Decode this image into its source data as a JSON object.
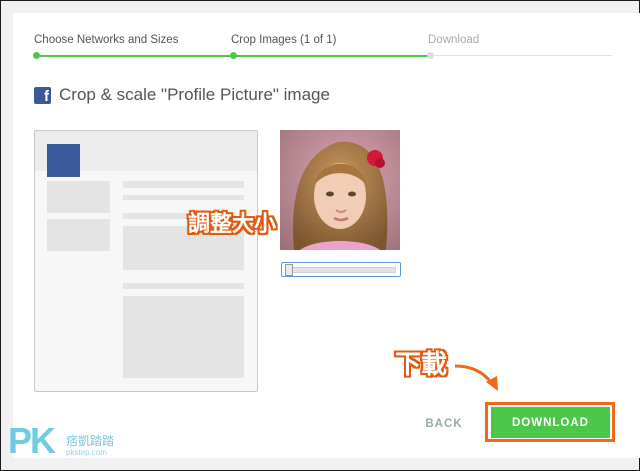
{
  "steps": [
    {
      "label": "Choose Networks and Sizes",
      "state": "done"
    },
    {
      "label": "Crop Images (1 of 1)",
      "state": "current"
    },
    {
      "label": "Download",
      "state": "pending"
    }
  ],
  "colors": {
    "accent": "#4cc74a",
    "facebook": "#3b5998",
    "annotation": "#e05a10"
  },
  "title": {
    "icon": "facebook-icon",
    "icon_glyph": "f",
    "text": "Crop & scale \"Profile Picture\" image"
  },
  "slider": {
    "value": 0.02
  },
  "annotations": {
    "resize": "調整大小",
    "download": "下載"
  },
  "buttons": {
    "back": "BACK",
    "download": "DOWNLOAD"
  },
  "watermark": {
    "logo": "PK",
    "name": "痞凱踏踏",
    "url": "pkstep.com"
  }
}
